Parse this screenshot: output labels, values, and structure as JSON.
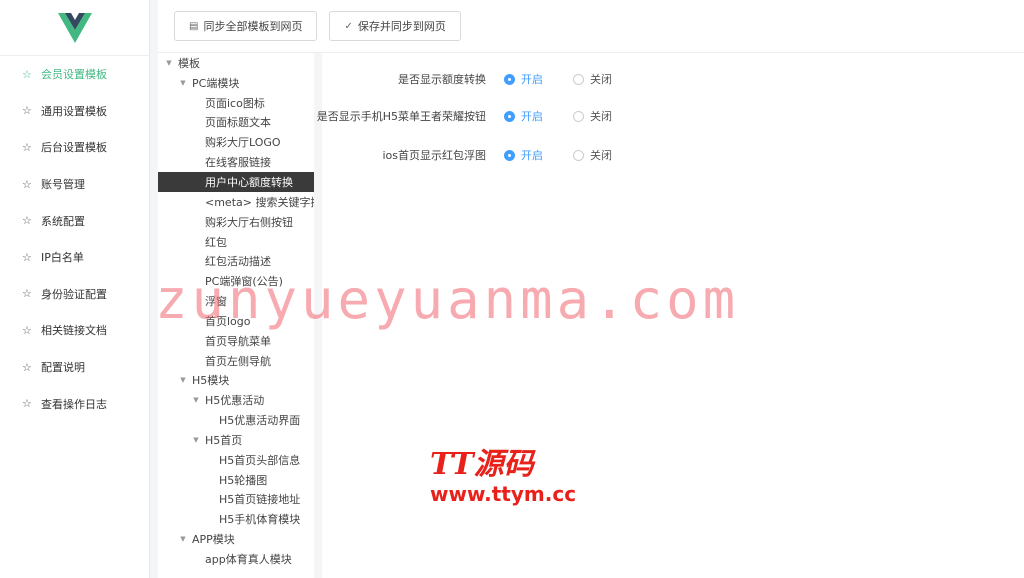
{
  "sidebar": {
    "items": [
      {
        "label": "会员设置模板"
      },
      {
        "label": "通用设置模板"
      },
      {
        "label": "后台设置模板"
      },
      {
        "label": "账号管理"
      },
      {
        "label": "系统配置"
      },
      {
        "label": "IP白名单"
      },
      {
        "label": "身份验证配置"
      },
      {
        "label": "相关链接文档"
      },
      {
        "label": "配置说明"
      },
      {
        "label": "查看操作日志"
      }
    ]
  },
  "toolbar": {
    "sync_all_label": "同步全部模板到网页",
    "save_sync_label": "保存并同步到网页"
  },
  "tree": {
    "nodes": [
      {
        "label": "模板"
      },
      {
        "label": "PC端模块"
      },
      {
        "label": "页面ico图标"
      },
      {
        "label": "页面标题文本"
      },
      {
        "label": "购彩大厅LOGO"
      },
      {
        "label": "在线客服链接"
      },
      {
        "label": "用户中心额度转换"
      },
      {
        "label": "<meta> 搜索关键字描"
      },
      {
        "label": "购彩大厅右侧按钮"
      },
      {
        "label": "红包"
      },
      {
        "label": "红包活动描述"
      },
      {
        "label": "PC端弹窗(公告)"
      },
      {
        "label": "浮窗"
      },
      {
        "label": "首页logo"
      },
      {
        "label": "首页导航菜单"
      },
      {
        "label": "首页左侧导航"
      },
      {
        "label": "H5模块"
      },
      {
        "label": "H5优惠活动"
      },
      {
        "label": "H5优惠活动界面"
      },
      {
        "label": "H5首页"
      },
      {
        "label": "H5首页头部信息"
      },
      {
        "label": "H5轮播图"
      },
      {
        "label": "H5首页链接地址"
      },
      {
        "label": "H5手机体育模块"
      },
      {
        "label": "APP模块"
      },
      {
        "label": "app体育真人模块"
      }
    ]
  },
  "form": {
    "rows": [
      {
        "label": "是否显示额度转换",
        "on": "开启",
        "off": "关闭"
      },
      {
        "label": "是否显示手机H5菜单王者荣耀按钮",
        "on": "开启",
        "off": "关闭"
      },
      {
        "label": "ios首页显示红包浮图",
        "on": "开启",
        "off": "关闭"
      }
    ]
  },
  "watermark": {
    "site": "zunyueyuanma.com",
    "brand": "TT源码",
    "url": "www.ttym.cc"
  },
  "colors": {
    "accent_green": "#42b983",
    "radio_blue": "#409eff",
    "selected_bg": "#3a3a3a",
    "watermark_red": "#e8211b"
  }
}
